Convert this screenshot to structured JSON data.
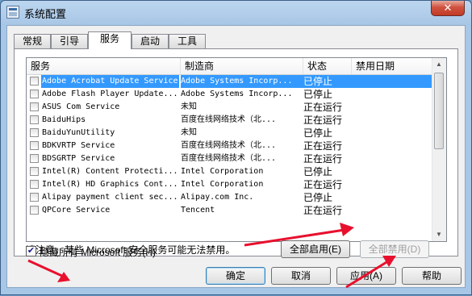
{
  "window": {
    "title": "系统配置",
    "close_glyph": "✕"
  },
  "tabs": [
    {
      "label": "常规",
      "active": false
    },
    {
      "label": "引导",
      "active": false
    },
    {
      "label": "服务",
      "active": true
    },
    {
      "label": "启动",
      "active": false
    },
    {
      "label": "工具",
      "active": false
    }
  ],
  "columns": {
    "service": "服务",
    "manufacturer": "制造商",
    "status": "状态",
    "disabled_date": "禁用日期"
  },
  "services": [
    {
      "name": "Adobe Acrobat Update Service",
      "manufacturer": "Adobe Systems Incorp...",
      "status": "已停止",
      "checked": false,
      "selected": true
    },
    {
      "name": "Adobe Flash Player Update...",
      "manufacturer": "Adobe Systems Incorp...",
      "status": "已停止",
      "checked": false,
      "selected": false
    },
    {
      "name": "ASUS Com Service",
      "manufacturer": "未知",
      "status": "正在运行",
      "checked": false,
      "selected": false
    },
    {
      "name": "BaiduHips",
      "manufacturer": "百度在线网络技术（北...",
      "status": "正在运行",
      "checked": false,
      "selected": false
    },
    {
      "name": "BaiduYunUtility",
      "manufacturer": "未知",
      "status": "已停止",
      "checked": false,
      "selected": false
    },
    {
      "name": "BDKVRTP Service",
      "manufacturer": "百度在线网络技术（北...",
      "status": "正在运行",
      "checked": false,
      "selected": false
    },
    {
      "name": "BDSGRTP Service",
      "manufacturer": "百度在线网络技术（北...",
      "status": "正在运行",
      "checked": false,
      "selected": false
    },
    {
      "name": "Intel(R) Content Protecti...",
      "manufacturer": "Intel Corporation",
      "status": "已停止",
      "checked": false,
      "selected": false
    },
    {
      "name": "Intel(R) HD Graphics Cont...",
      "manufacturer": "Intel Corporation",
      "status": "正在运行",
      "checked": false,
      "selected": false
    },
    {
      "name": "Alipay payment client sec...",
      "manufacturer": "Alipay.com Inc.",
      "status": "已停止",
      "checked": false,
      "selected": false
    },
    {
      "name": "QPCore Service",
      "manufacturer": "Tencent",
      "status": "正在运行",
      "checked": false,
      "selected": false
    }
  ],
  "note": "请注意，某些 Microsoft 安全服务可能无法禁用。",
  "buttons": {
    "enable_all": "全部启用(E)",
    "disable_all": "全部禁用(D)",
    "ok": "确定",
    "cancel": "取消",
    "apply": "应用(A)",
    "help": "帮助"
  },
  "hide_ms": {
    "label": "隐藏所有 Microsoft 服务(H)",
    "checked": true,
    "check_glyph": "✔"
  },
  "colors": {
    "annotation_arrow": "#e8102e",
    "selection": "#3399ff"
  }
}
